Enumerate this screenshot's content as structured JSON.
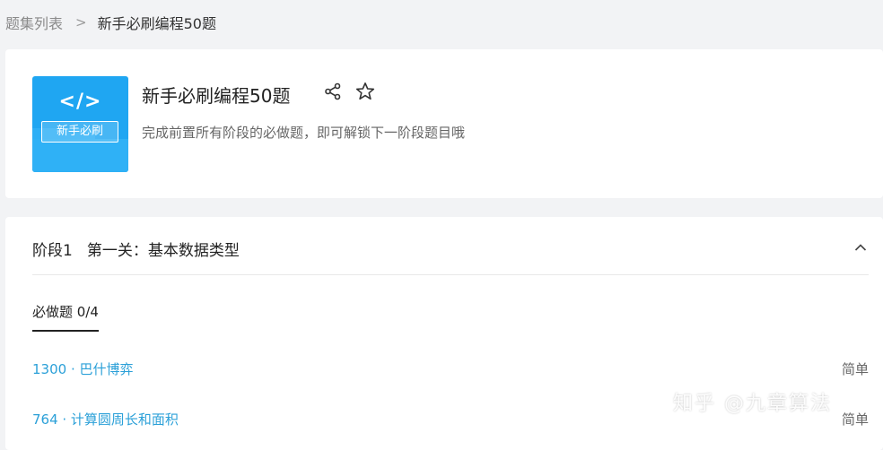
{
  "breadcrumb": {
    "parent": "题集列表",
    "separator": ">",
    "current": "新手必刷编程50题"
  },
  "problem_set": {
    "cover_code": "</>",
    "cover_badge": "新手必刷",
    "title": "新手必刷编程50题",
    "description": "完成前置所有阶段的必做题，即可解锁下一阶段题目哦",
    "actions": [
      "share-icon",
      "star-icon"
    ]
  },
  "stage": {
    "label": "阶段1",
    "name": "第一关：基本数据类型",
    "tab_label": "必做题 0/4",
    "problems": [
      {
        "id_title": "1300 · 巴什博弈",
        "difficulty": "简单"
      },
      {
        "id_title": "764 · 计算圆周长和面积",
        "difficulty": "简单"
      }
    ]
  },
  "watermark": "知乎 @九章算法",
  "colors": {
    "accent_link": "#2ba0d8",
    "cover_blue": "#1fa6f2",
    "page_bg": "#f2f3f5"
  }
}
